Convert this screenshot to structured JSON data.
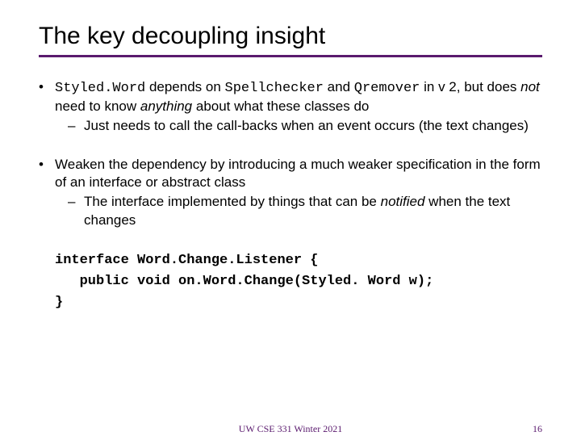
{
  "title": "The key decoupling insight",
  "bullet1": {
    "code1": "Styled.Word",
    "t1": " depends on ",
    "code2": "Spellchecker",
    "t2": " and ",
    "code3": "Qremover",
    "t3": " in v 2, but does ",
    "not": "not",
    "t4": " need to know ",
    "anything": "anything",
    "t5": " about what these classes do",
    "sub": "Just needs to call the call-backs when an event occurs (the text changes)"
  },
  "bullet2": {
    "main": "Weaken the dependency by introducing a much weaker specification in the form of an interface or abstract class",
    "sub_a": "The interface implemented by things that can be ",
    "sub_i": "notified",
    "sub_b": " when the text changes"
  },
  "code": {
    "l1": "interface Word.Change.Listener {",
    "l2": "   public void on.Word.Change(Styled. Word w);",
    "l3": "}"
  },
  "footer": {
    "center": "UW CSE 331 Winter 2021",
    "page": "16"
  }
}
